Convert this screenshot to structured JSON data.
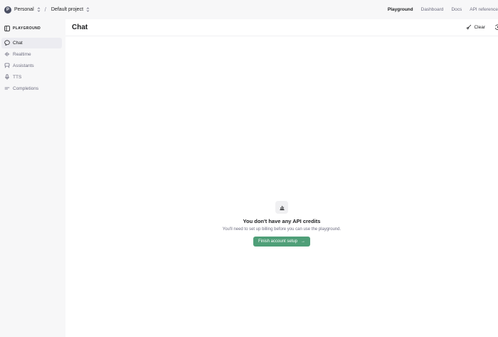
{
  "topbar": {
    "org_initial": "P",
    "org_name": "Personal",
    "separator": "/",
    "project_name": "Default project",
    "nav": [
      {
        "label": "Playground",
        "active": true
      },
      {
        "label": "Dashboard",
        "active": false
      },
      {
        "label": "Docs",
        "active": false
      },
      {
        "label": "API reference",
        "active": false
      }
    ]
  },
  "sidebar": {
    "brand": "PLAYGROUND",
    "brand_icon": "sidebar-panel-icon",
    "items": [
      {
        "label": "Chat",
        "icon": "chat-bubble-icon",
        "active": true
      },
      {
        "label": "Realtime",
        "icon": "waveform-icon",
        "active": false
      },
      {
        "label": "Assistants",
        "icon": "assistant-icon",
        "active": false
      },
      {
        "label": "TTS",
        "icon": "microphone-icon",
        "active": false
      },
      {
        "label": "Completions",
        "icon": "text-lines-icon",
        "active": false
      }
    ]
  },
  "main": {
    "title": "Chat",
    "clear_label": "Clear",
    "clear_icon": "broom-icon",
    "history_icon": "history-icon"
  },
  "empty_state": {
    "icon": "bar-chart-icon",
    "title": "You don't have any API credits",
    "text": "You'll need to set up billing before you can use the playground.",
    "cta_label": "Finish account setup",
    "cta_arrow": "→"
  },
  "colors": {
    "accent_green": "#4f9f78",
    "sidebar_bg": "#f7f7f8",
    "active_item_bg": "#ececf1",
    "muted_text": "#6e6e80"
  }
}
